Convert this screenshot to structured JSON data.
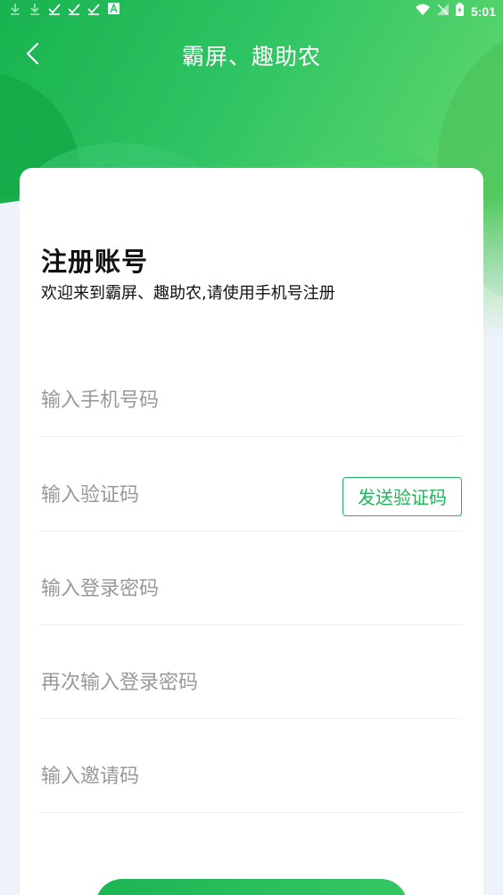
{
  "status_bar": {
    "time": "5:01",
    "left_icons": [
      "download-icon",
      "download-icon",
      "check-icon",
      "check-icon",
      "check-icon",
      "a-icon"
    ],
    "right_icons": [
      "wifi-icon",
      "no-signal-icon",
      "battery-charging-icon"
    ]
  },
  "header": {
    "title": "霸屏、趣助农",
    "back_icon": "chevron-left-icon"
  },
  "form": {
    "heading": "注册账号",
    "subheading": "欢迎来到霸屏、趣助农,请使用手机号注册",
    "phone_placeholder": "输入手机号码",
    "code_placeholder": "输入验证码",
    "send_code_label": "发送验证码",
    "password_placeholder": "输入登录密码",
    "confirm_password_placeholder": "再次输入登录密码",
    "invite_code_placeholder": "输入邀请码"
  },
  "colors": {
    "primary_green": "#1fb45a",
    "placeholder_gray": "#999999"
  }
}
